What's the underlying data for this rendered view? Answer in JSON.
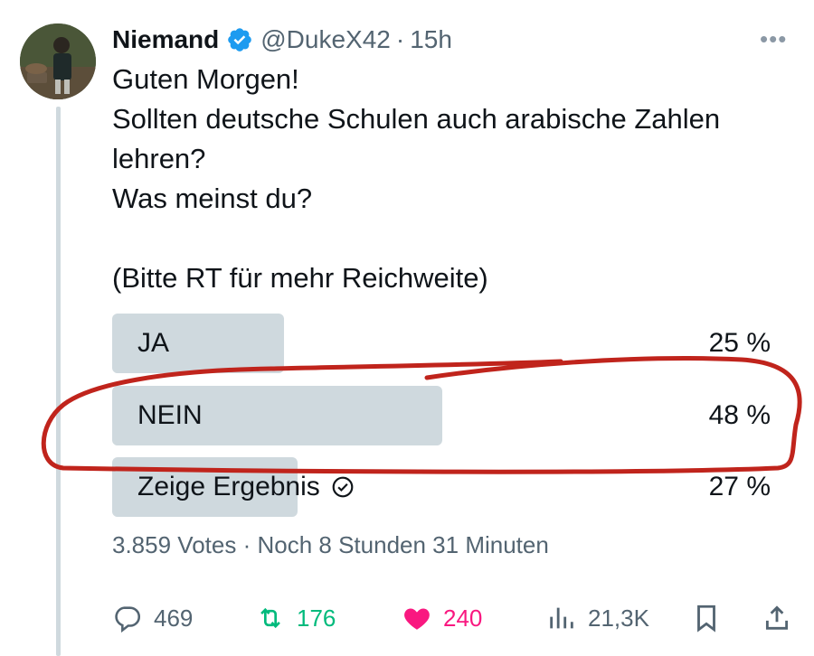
{
  "author": {
    "name": "Niemand",
    "handle": "@DukeX42",
    "separator": "·",
    "time": "15h",
    "more_label": "•••"
  },
  "tweet": {
    "lines": [
      "Guten Morgen!",
      "Sollten deutsche Schulen auch arabische Zahlen",
      "lehren?",
      "Was meinst du?",
      "",
      "(Bitte RT für mehr Reichweite)"
    ]
  },
  "poll": {
    "options": [
      {
        "label": "JA",
        "percent": "25 %",
        "value": 25
      },
      {
        "label": "NEIN",
        "percent": "48 %",
        "value": 48
      },
      {
        "label": "Zeige Ergebnis",
        "percent": "27 %",
        "value": 27
      }
    ],
    "votes": "3.859 Votes",
    "separator": "·",
    "remaining": "Noch 8 Stunden 31 Minuten"
  },
  "actions": {
    "replies": "469",
    "retweets": "176",
    "likes": "240",
    "views": "21,3K"
  },
  "colors": {
    "bar": "#cfd9de",
    "verified": "#1d9bf0",
    "retweet": "#00ba7c",
    "like": "#f91880",
    "annotation": "#c0241c"
  },
  "icons": [
    "verified-badge-icon",
    "more-icon",
    "check-circle-icon",
    "reply-icon",
    "retweet-icon",
    "like-icon",
    "views-icon",
    "bookmark-icon",
    "share-icon"
  ]
}
